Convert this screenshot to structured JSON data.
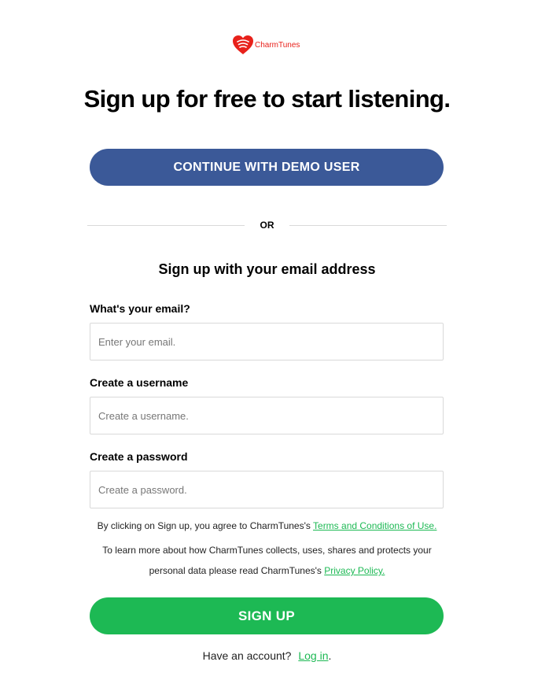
{
  "brand": {
    "name": "CharmTunes",
    "logo_icon": "heart-waves-icon",
    "color": "#e8211b"
  },
  "title": "Sign up for free to start listening.",
  "demo_button": {
    "label": "CONTINUE WITH DEMO USER",
    "color": "#3b5998"
  },
  "divider": {
    "label": "OR"
  },
  "subtitle": "Sign up with your email address",
  "form": {
    "email": {
      "label": "What's your email?",
      "placeholder": "Enter your email.",
      "value": ""
    },
    "username": {
      "label": "Create a username",
      "placeholder": "Create a username.",
      "value": ""
    },
    "password": {
      "label": "Create a password",
      "placeholder": "Create a password.",
      "value": ""
    }
  },
  "legal": {
    "line1_text": "By clicking on Sign up, you agree to CharmTunes's ",
    "terms_link": "Terms and Conditions of Use.",
    "line2_text": "To learn more about how CharmTunes collects, uses, shares and protects your",
    "line3_text": "personal data please read CharmTunes's ",
    "privacy_link": "Privacy Policy."
  },
  "signup_button": {
    "label": "SIGN UP",
    "color": "#1db954"
  },
  "login": {
    "prompt": "Have an account?",
    "link": "Log in",
    "suffix": "."
  }
}
